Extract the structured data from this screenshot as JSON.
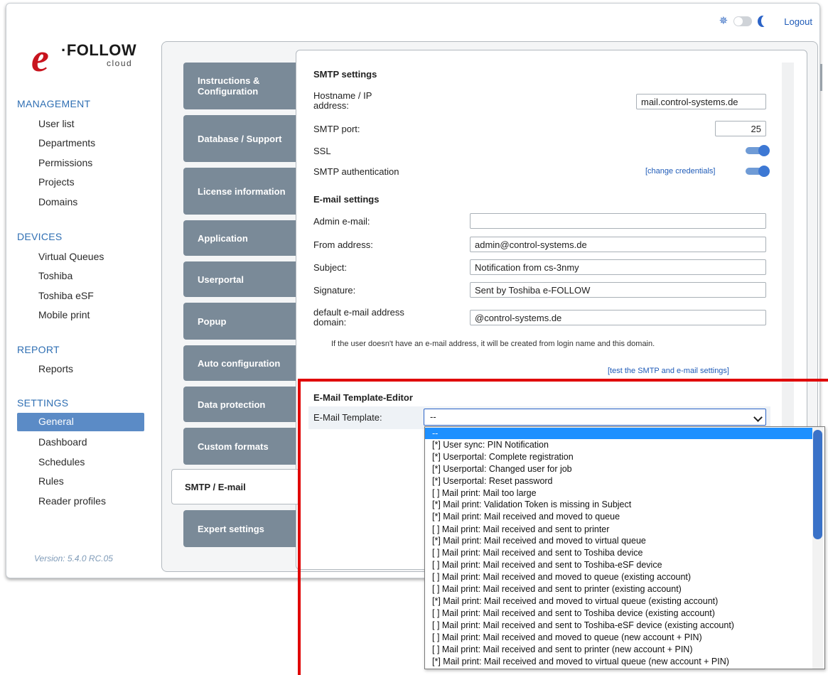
{
  "header": {
    "logout": "Logout"
  },
  "logo": {
    "e": "e",
    "follow": "·FOLLOW",
    "cloud": "cloud"
  },
  "sidebar": {
    "sections": [
      {
        "title": "MANAGEMENT",
        "items": [
          "User list",
          "Departments",
          "Permissions",
          "Projects",
          "Domains"
        ]
      },
      {
        "title": "DEVICES",
        "items": [
          "Virtual Queues",
          "Toshiba",
          "Toshiba eSF",
          "Mobile print"
        ]
      },
      {
        "title": "REPORT",
        "items": [
          "Reports"
        ]
      },
      {
        "title": "SETTINGS",
        "items": [
          "General",
          "Dashboard",
          "Schedules",
          "Rules",
          "Reader profiles"
        ]
      }
    ],
    "active_item": "General",
    "version": "Version: 5.4.0 RC.05"
  },
  "tabs": [
    "Instructions & Configuration",
    "Database / Support",
    "License information",
    "Application",
    "Userportal",
    "Popup",
    "Auto configuration",
    "Data protection",
    "Custom formats",
    "SMTP / E-mail",
    "Expert settings"
  ],
  "active_tab": "SMTP / E-mail",
  "smtp": {
    "title": "SMTP settings",
    "hostname_label": "Hostname / IP address:",
    "hostname_value": "mail.control-systems.de",
    "port_label": "SMTP port:",
    "port_value": "25",
    "ssl_label": "SSL",
    "ssl_enabled": true,
    "auth_label": "SMTP authentication",
    "auth_enabled": true,
    "change_credentials": "[change credentials]"
  },
  "email": {
    "title": "E-mail settings",
    "admin_label": "Admin e-mail:",
    "admin_value": "",
    "from_label": "From address:",
    "from_value": "admin@control-systems.de",
    "subject_label": "Subject:",
    "subject_value": "Notification from cs-3nmy",
    "signature_label": "Signature:",
    "signature_value": "Sent by Toshiba e-FOLLOW",
    "domain_label": "default e-mail address domain:",
    "domain_value": "@control-systems.de",
    "note": "If the user doesn't have an e-mail address, it will be created from login name and this domain.",
    "test_link": "[test the SMTP and e-mail settings]"
  },
  "template_editor": {
    "title": "E-Mail Template-Editor",
    "label": "E-Mail Template:",
    "selected": "--",
    "options": [
      "--",
      "[*] User sync: PIN Notification",
      "[*] Userportal: Complete registration",
      "[*] Userportal: Changed user for job",
      "[*] Userportal: Reset password",
      "[ ] Mail print: Mail too large",
      "[*] Mail print: Validation Token is missing in Subject",
      "[*] Mail print: Mail received and moved to queue",
      "[ ] Mail print: Mail received and sent to printer",
      "[*] Mail print: Mail received and moved to virtual queue",
      "[ ] Mail print: Mail received and sent to Toshiba device",
      "[ ] Mail print: Mail received and sent to Toshiba-eSF device",
      "[ ] Mail print: Mail received and moved to queue (existing account)",
      "[ ] Mail print: Mail received and sent to printer (existing account)",
      "[*] Mail print: Mail received and moved to virtual queue (existing account)",
      "[ ] Mail print: Mail received and sent to Toshiba device (existing account)",
      "[ ] Mail print: Mail received and sent to Toshiba-eSF device (existing account)",
      "[ ] Mail print: Mail received and moved to queue (new account + PIN)",
      "[ ] Mail print: Mail received and sent to printer (new account + PIN)",
      "[*] Mail print: Mail received and moved to virtual queue (new account + PIN)"
    ]
  },
  "colors": {
    "accent": "#3d78d4",
    "tab_bg": "#7a8a98",
    "highlight": "#e00000",
    "section_head": "#2f6fb3"
  }
}
